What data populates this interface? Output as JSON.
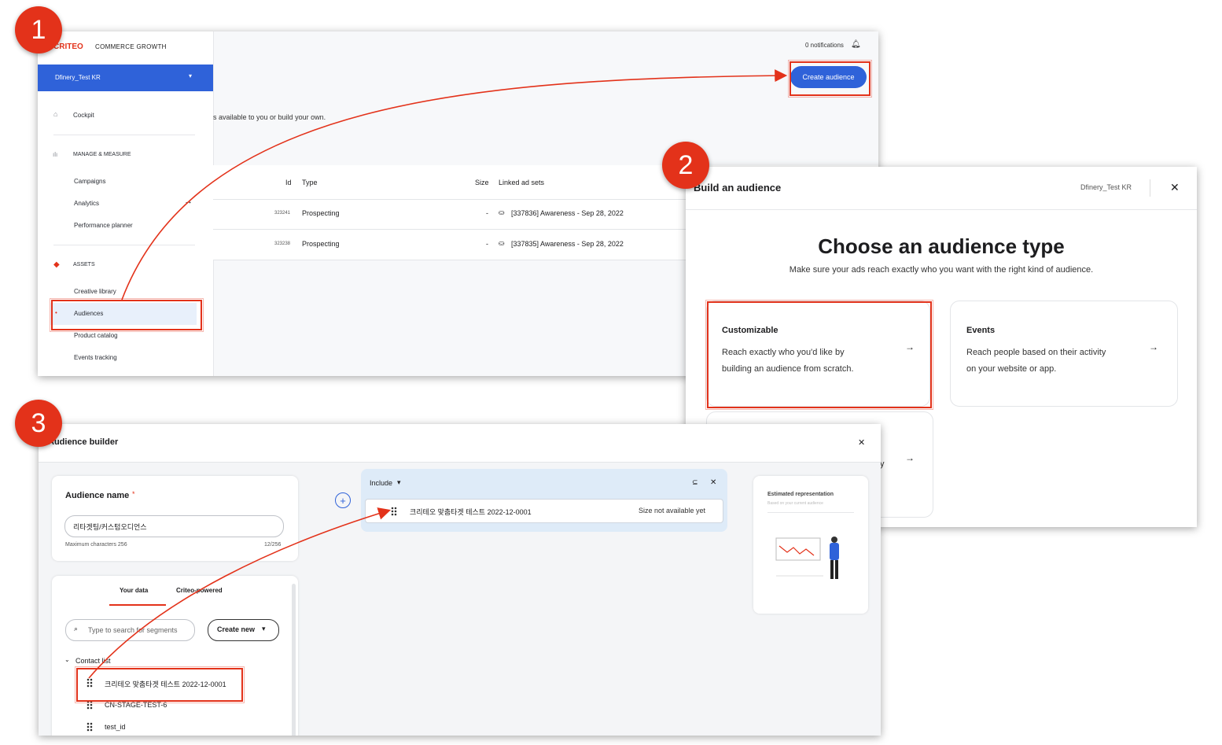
{
  "steps": [
    "1",
    "2",
    "3"
  ],
  "shot1": {
    "brand_logo": "CRITEO",
    "brand_product": "COMMERCE GROWTH",
    "account": "Dfinery_Test KR",
    "notifications": "0 notifications",
    "create_button": "Create audience",
    "subtitle_fragment": "s available to you or build your own.",
    "nav": {
      "cockpit": "Cockpit",
      "manage_section": "MANAGE & MEASURE",
      "campaigns": "Campaigns",
      "analytics": "Analytics",
      "performance_planner": "Performance planner",
      "assets_section": "ASSETS",
      "creative_library": "Creative library",
      "audiences": "Audiences",
      "product_catalog": "Product catalog",
      "events_tracking": "Events tracking"
    },
    "table": {
      "headers": {
        "id": "Id",
        "type": "Type",
        "size": "Size",
        "linked": "Linked ad sets"
      },
      "rows": [
        {
          "id": "323241",
          "type": "Prospecting",
          "size": "-",
          "linked": "[337836]  Awareness - Sep 28, 2022"
        },
        {
          "id": "323238",
          "type": "Prospecting",
          "size": "-",
          "linked": "[337835]  Awareness - Sep 28, 2022"
        }
      ]
    }
  },
  "shot2": {
    "title": "Build an audience",
    "account": "Dfinery_Test KR",
    "heading": "Choose an audience type",
    "subheading": "Make sure your ads reach exactly who you want with the right kind of audience.",
    "cards": [
      {
        "title": "Customizable",
        "line1": "Reach exactly who you'd like by",
        "line2": "building an audience from scratch."
      },
      {
        "title": "Events",
        "line1": "Reach people based on their activity",
        "line2": "on your website or app."
      }
    ],
    "partial_text": "y"
  },
  "shot3": {
    "title": "Audience builder",
    "name_label": "Audience name",
    "required_mark": "*",
    "name_value": "리타겟팅/커스텀오디언스",
    "max_chars": "Maximum characters 256",
    "char_count": "12/256",
    "tabs": [
      "Your data",
      "Criteo-powered"
    ],
    "search_placeholder": "Type to search for segments",
    "create_new": "Create new",
    "group": "Contact list",
    "segments": [
      "크리테오 맞춤타겟 테스트 2022-12-0001",
      "CN-STAGE-TEST-6",
      "test_id"
    ],
    "include_label": "Include",
    "include_item": "크리테오 맞춤타겟 테스트 2022-12-0001",
    "include_size": "Size not available yet",
    "estimate_title": "Estimated representation",
    "estimate_sub": "Based on your current audience"
  },
  "colors": {
    "accent": "#2f62d9",
    "highlight": "#e3321a"
  }
}
